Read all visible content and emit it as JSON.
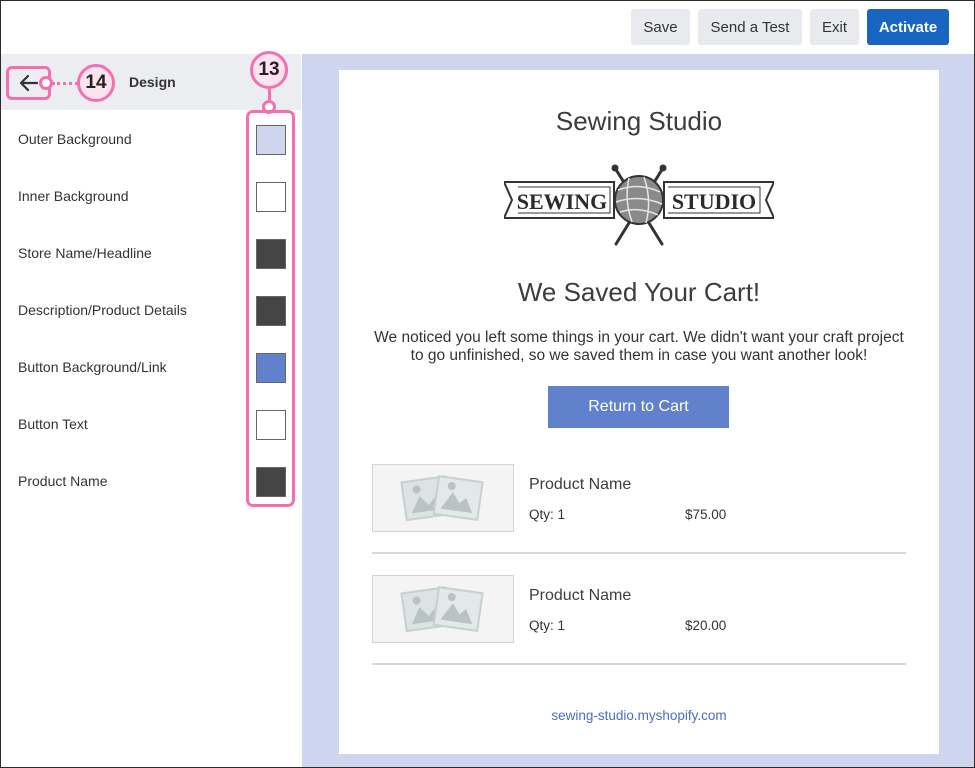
{
  "toolbar": {
    "save_label": "Save",
    "send_test_label": "Send a Test",
    "exit_label": "Exit",
    "activate_label": "Activate"
  },
  "sidebar": {
    "title": "Design",
    "back_icon": "arrow-left-icon",
    "callout_back": "14",
    "callout_swatches": "13",
    "settings": [
      {
        "label": "Outer Background",
        "color": "#cdd6ee"
      },
      {
        "label": "Inner Background",
        "color": "#ffffff"
      },
      {
        "label": "Store Name/Headline",
        "color": "#454545"
      },
      {
        "label": "Description/Product Details",
        "color": "#454545"
      },
      {
        "label": "Button Background/Link",
        "color": "#6281cc"
      },
      {
        "label": "Button Text",
        "color": "#ffffff"
      },
      {
        "label": "Product Name",
        "color": "#454545"
      }
    ]
  },
  "preview": {
    "store_name": "Sewing Studio",
    "logo_text_left": "SEWING",
    "logo_text_right": "STUDIO",
    "headline": "We Saved Your Cart!",
    "description": "We noticed you left some things in your cart. We didn't want your craft project to go unfinished, so we saved them in case you want another look!",
    "button_label": "Return to Cart",
    "products": [
      {
        "name": "Product Name",
        "qty": "Qty: 1",
        "price": "$75.00"
      },
      {
        "name": "Product Name",
        "qty": "Qty: 1",
        "price": "$20.00"
      }
    ],
    "footer_link": "sewing-studio.myshopify.com"
  },
  "colors": {
    "accent": "#1966c2",
    "callout": "#f46fb0",
    "button": "#6281cc",
    "outer_bg": "#cdd6ee"
  }
}
